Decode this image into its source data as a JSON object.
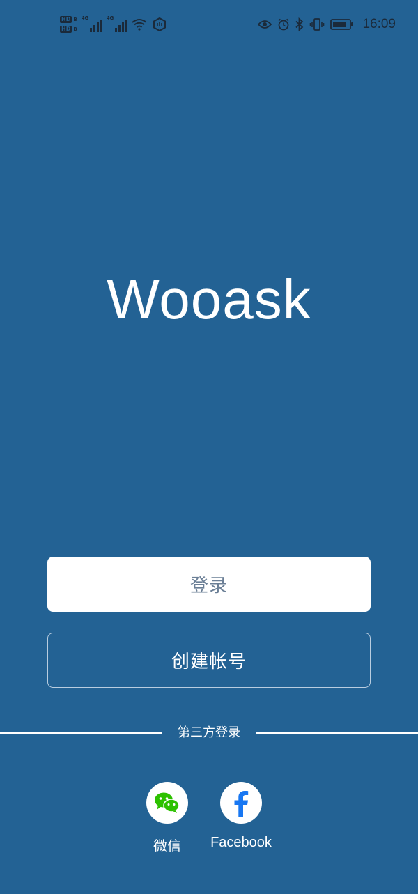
{
  "status_bar": {
    "network_left": "HD",
    "network_left_sub": "B",
    "network_type": "4G",
    "time": "16:09",
    "icons": [
      "hd-icon",
      "signal-icon",
      "wifi-icon",
      "hotspot-icon",
      "eye-icon",
      "alarm-icon",
      "bluetooth-icon",
      "vibrate-icon",
      "battery-icon"
    ]
  },
  "brand": {
    "title": "Wooask"
  },
  "buttons": {
    "login_label": "登录",
    "create_account_label": "创建帐号"
  },
  "third_party": {
    "divider_label": "第三方登录",
    "providers": [
      {
        "label": "微信",
        "icon": "wechat-icon",
        "color": "#2DC100"
      },
      {
        "label": "Facebook",
        "icon": "facebook-icon",
        "color": "#1877F2"
      }
    ]
  },
  "colors": {
    "background": "#236294",
    "login_text": "#6b7f96"
  }
}
